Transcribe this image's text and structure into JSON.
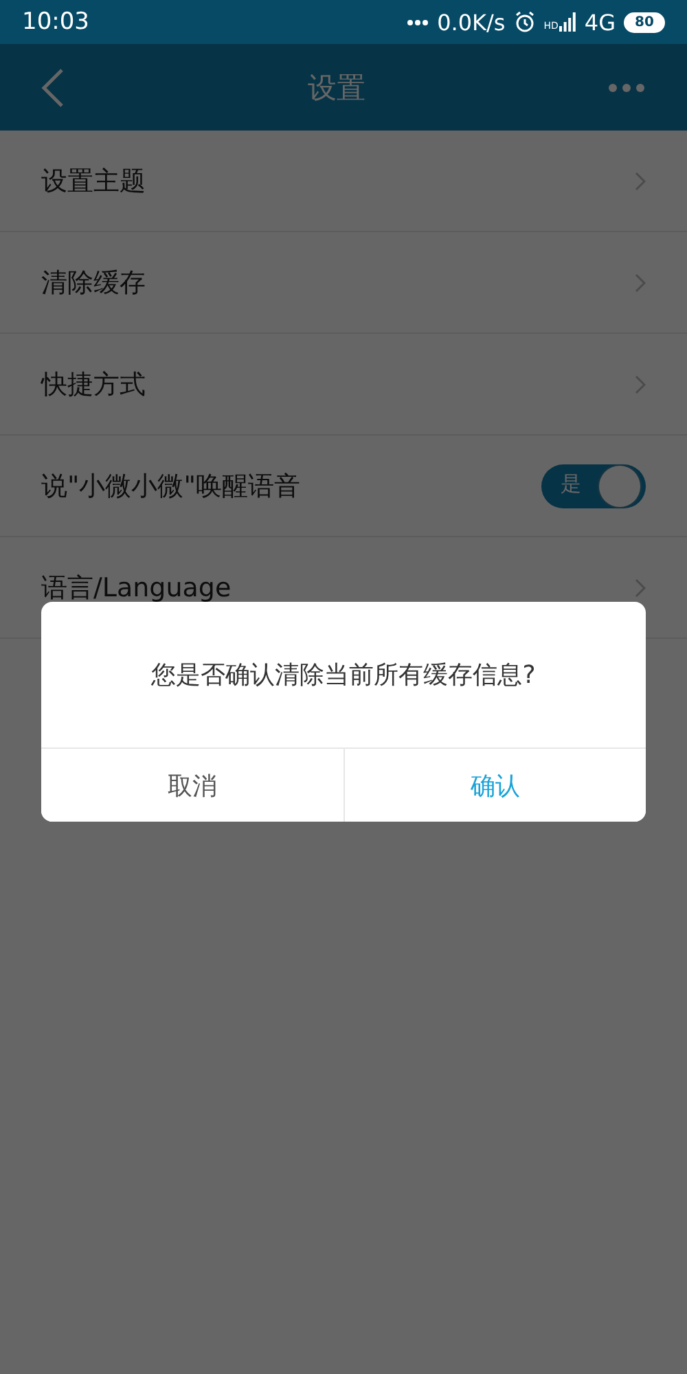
{
  "status_bar": {
    "time": "10:03",
    "speed": "0.0K/s",
    "hd": "HD",
    "network": "4G",
    "battery": "80"
  },
  "header": {
    "title": "设置"
  },
  "settings": [
    {
      "kind": "link",
      "label": "设置主题"
    },
    {
      "kind": "link",
      "label": "清除缓存"
    },
    {
      "kind": "link",
      "label": "快捷方式"
    },
    {
      "kind": "toggle",
      "label": "说\"小微小微\"唤醒语音",
      "on": true,
      "toggle_text": "是"
    },
    {
      "kind": "link",
      "label": "语言/Language"
    }
  ],
  "dialog": {
    "message": "您是否确认清除当前所有缓存信息?",
    "buttons": [
      {
        "label": "取消",
        "primary": false
      },
      {
        "label": "确认",
        "primary": true
      }
    ]
  }
}
